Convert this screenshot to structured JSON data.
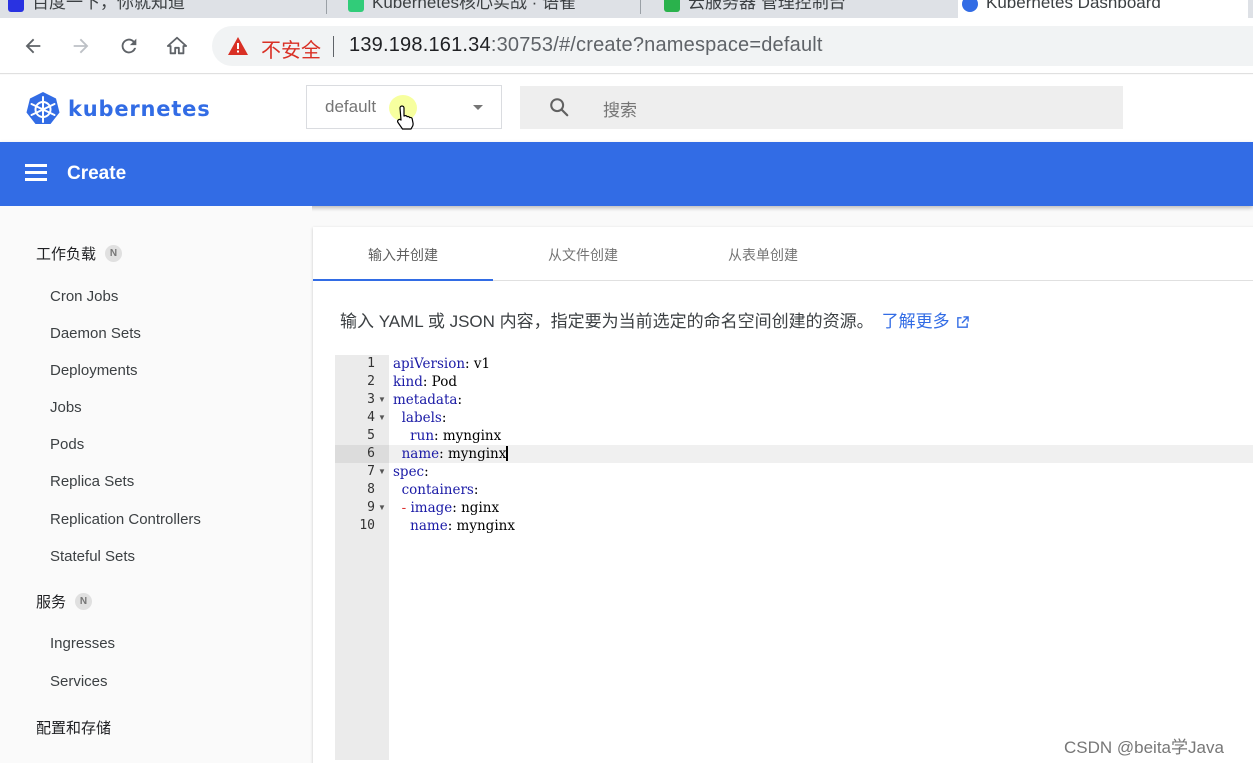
{
  "browser": {
    "tabs": [
      {
        "label": "百度一下，你就知道"
      },
      {
        "label": "Kubernetes核心实战 · 语雀"
      },
      {
        "label": "云服务器 管理控制台"
      },
      {
        "label": "Kubernetes Dashboard"
      }
    ],
    "insecure_label": "不安全",
    "url_host": "139.198.161.34",
    "url_rest": ":30753/#/create?namespace=default"
  },
  "app": {
    "brand": "kubernetes",
    "namespace": "default",
    "search_placeholder": "搜索",
    "toolbar_title": "Create"
  },
  "sidebar": {
    "workloads": {
      "label": "工作负载",
      "badge": "N"
    },
    "workload_items": [
      "Cron Jobs",
      "Daemon Sets",
      "Deployments",
      "Jobs",
      "Pods",
      "Replica Sets",
      "Replication Controllers",
      "Stateful Sets"
    ],
    "service": {
      "label": "服务",
      "badge": "N"
    },
    "service_items": [
      "Ingresses",
      "Services"
    ],
    "config": {
      "label": "配置和存储"
    }
  },
  "create": {
    "tabs": [
      "输入并创建",
      "从文件创建",
      "从表单创建"
    ],
    "description": "输入 YAML 或 JSON 内容，指定要为当前选定的命名空间创建的资源。",
    "learn_more": "了解更多"
  },
  "editor": {
    "lines": [
      {
        "n": "1",
        "key": "apiVersion",
        "val": "v1",
        "indent": "",
        "fold": false
      },
      {
        "n": "2",
        "key": "kind",
        "val": "Pod",
        "indent": "",
        "fold": false
      },
      {
        "n": "3",
        "key": "metadata",
        "val": "",
        "indent": "",
        "fold": true
      },
      {
        "n": "4",
        "key": "labels",
        "val": "",
        "indent": "  ",
        "fold": true
      },
      {
        "n": "5",
        "key": "run",
        "val": "mynginx",
        "indent": "    ",
        "fold": false
      },
      {
        "n": "6",
        "key": "name",
        "val": "mynginx",
        "indent": "  ",
        "fold": false
      },
      {
        "n": "7",
        "key": "spec",
        "val": "",
        "indent": "",
        "fold": true
      },
      {
        "n": "8",
        "key": "containers",
        "val": "",
        "indent": "  ",
        "fold": false
      },
      {
        "n": "9",
        "key": "image",
        "val": "nginx",
        "indent": "  ",
        "dash": true,
        "fold": true
      },
      {
        "n": "10",
        "key": "name",
        "val": "mynginx",
        "indent": "    ",
        "fold": false
      }
    ],
    "active_line": 6
  },
  "watermark": "CSDN @beita学Java",
  "colors": {
    "brand": "#326ce5",
    "warning": "#d93025"
  }
}
